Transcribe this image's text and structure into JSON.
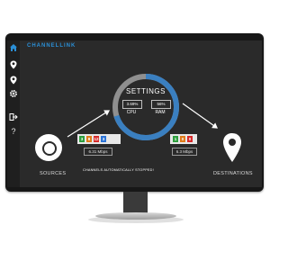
{
  "app": {
    "brand": "CHANNELLINK"
  },
  "sidebar": {
    "items": [
      {
        "icon": "home-icon"
      },
      {
        "icon": "location-pin-icon"
      },
      {
        "icon": "location-pin-icon"
      },
      {
        "icon": "gear-icon"
      },
      {
        "icon": "logout-icon"
      },
      {
        "icon": "help-icon",
        "label": "?"
      }
    ]
  },
  "settings": {
    "title": "SETTINGS",
    "cpu_value": "3.69%",
    "ram_value": "56%",
    "cpu_label": "CPU",
    "ram_label": "RAM"
  },
  "sources": {
    "label": "SOURCES",
    "warning": "CHANNELS AUTOMATICALLY STOPPED!",
    "chips": [
      {
        "value": "3",
        "color": "#2e9e3d"
      },
      {
        "value": "8",
        "color": "#e07b1a"
      },
      {
        "value": "12",
        "color": "#d62a2a"
      },
      {
        "value": "3",
        "color": "#2b73d6"
      }
    ],
    "rate": "6.31 Mbps"
  },
  "destinations": {
    "label": "DESTINATIONS",
    "chips": [
      {
        "value": "1",
        "color": "#2e9e3d"
      },
      {
        "value": "0",
        "color": "#e07b1a"
      },
      {
        "value": "0",
        "color": "#d62a2a"
      }
    ],
    "rate": "6.3 Mbps"
  },
  "colors": {
    "accent": "#2b8fd6",
    "screen_bg": "#2a2a2a",
    "gauge_ring": "#3a7fc0"
  }
}
